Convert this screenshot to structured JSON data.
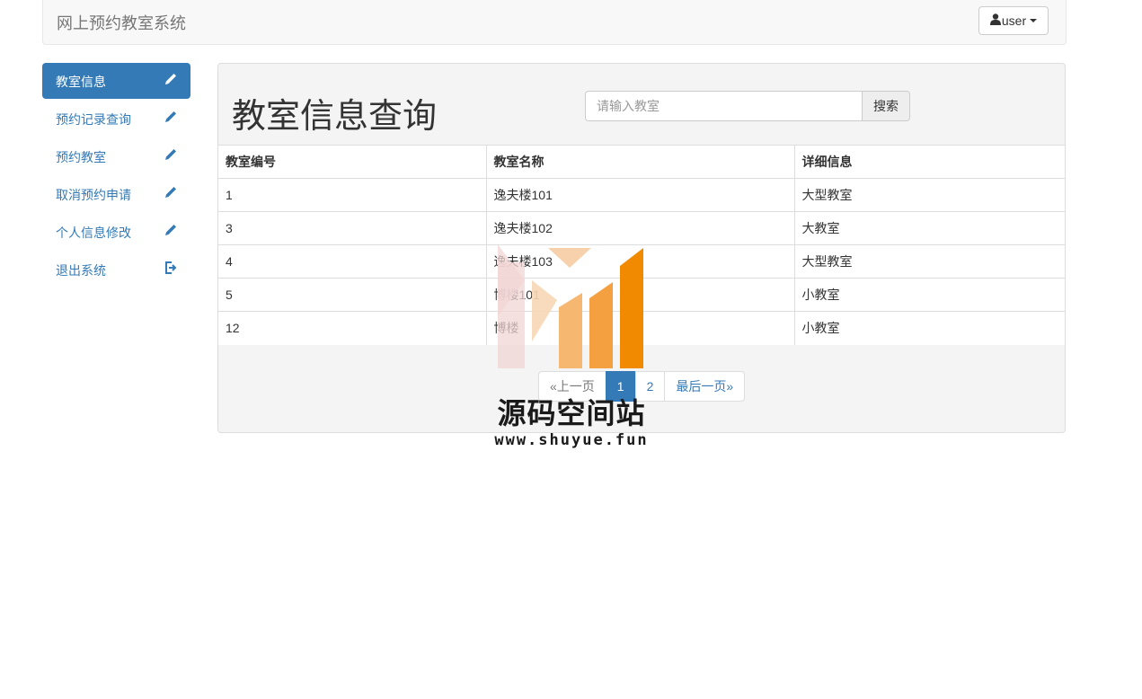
{
  "header": {
    "brand": "网上预约教室系统",
    "user_label": "user"
  },
  "sidebar": {
    "items": [
      {
        "label": "教室信息",
        "icon": "pencil-icon",
        "active": true
      },
      {
        "label": "预约记录查询",
        "icon": "pencil-icon"
      },
      {
        "label": "预约教室",
        "icon": "pencil-icon"
      },
      {
        "label": "取消预约申请",
        "icon": "pencil-icon"
      },
      {
        "label": "个人信息修改",
        "icon": "pencil-icon"
      },
      {
        "label": "退出系统",
        "icon": "logout-icon"
      }
    ]
  },
  "main": {
    "title": "教室信息查询",
    "search": {
      "placeholder": "请输入教室",
      "value": "",
      "button": "搜索"
    },
    "table": {
      "headers": [
        "教室编号",
        "教室名称",
        "详细信息"
      ],
      "rows": [
        [
          "1",
          "逸夫楼101",
          "大型教室"
        ],
        [
          "3",
          "逸夫楼102",
          "大教室"
        ],
        [
          "4",
          "逸夫楼103",
          "大型教室"
        ],
        [
          "5",
          "博楼101",
          "小教室"
        ],
        [
          "12",
          "博楼",
          "小教室"
        ]
      ]
    },
    "pagination": {
      "prev": "«上一页",
      "pages": [
        "1",
        "2"
      ],
      "current": "1",
      "last": "最后一页»"
    }
  },
  "watermark": {
    "title": "源码空间站",
    "url": "www.shuyue.fun"
  },
  "colors": {
    "primary": "#337ab7",
    "watermark_orange": "#f28a00"
  }
}
